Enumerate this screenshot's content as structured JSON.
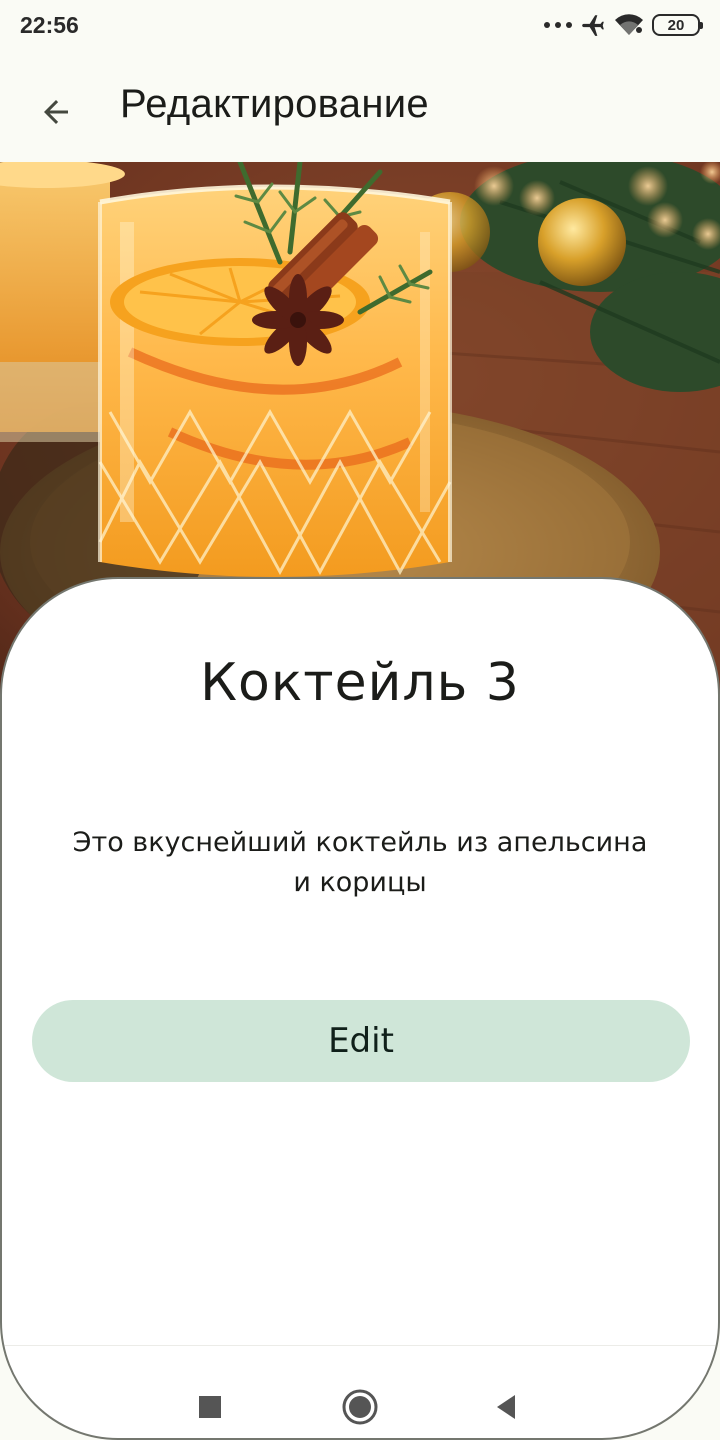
{
  "status_bar": {
    "time": "22:56",
    "battery_level": "20",
    "icons": [
      "more-dots-icon",
      "airplane-mode-icon",
      "wifi-icon",
      "battery-icon"
    ]
  },
  "app_bar": {
    "title": "Редактирование",
    "back_icon": "arrow-back-icon"
  },
  "hero": {
    "image": "orange cocktail with rosemary, cinnamon and star anise"
  },
  "card": {
    "title": "Коктейль 3",
    "description": "Это вкуснейший коктейль из апельсина и корицы",
    "edit_button_label": "Edit"
  },
  "nav_bar": {
    "buttons": [
      "recents-square-icon",
      "home-circle-icon",
      "back-triangle-icon"
    ]
  },
  "colors": {
    "background": "#fafbf5",
    "card": "#ffffff",
    "card_border": "#74776f",
    "button_container": "#cfe6d8",
    "text": "#1b1c19"
  }
}
